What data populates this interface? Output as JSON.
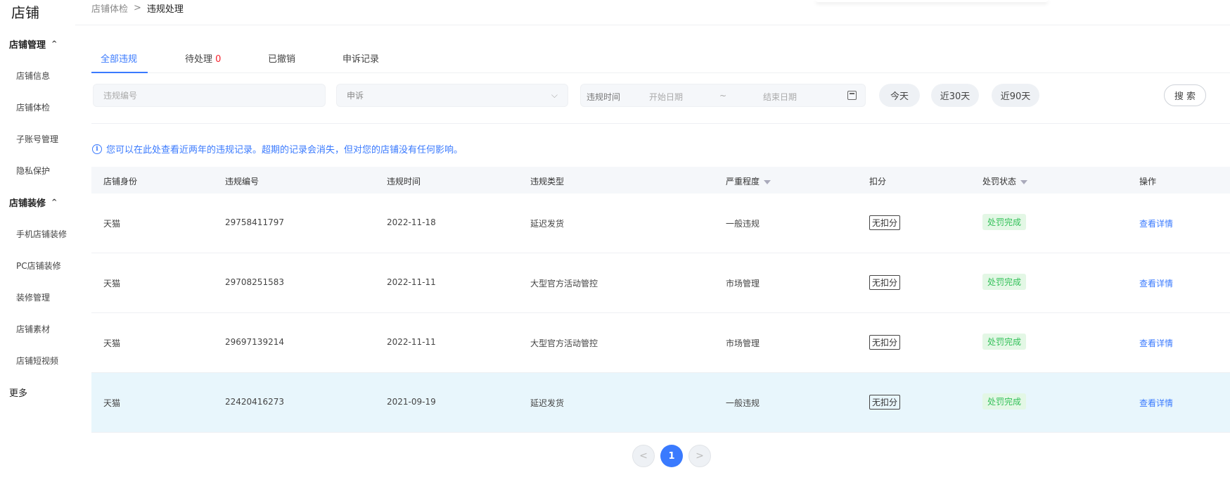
{
  "sidebar": {
    "brand": "店铺",
    "sections": [
      {
        "label": "店铺管理",
        "items": [
          "店铺信息",
          "店铺体检",
          "子账号管理",
          "隐私保护"
        ]
      },
      {
        "label": "店铺装修",
        "items": [
          "手机店铺装修",
          "PC店铺装修",
          "装修管理",
          "店铺素材",
          "店铺短视频"
        ]
      }
    ],
    "more": "更多",
    "chevron": "^"
  },
  "breadcrumb": {
    "parent": "店铺体检",
    "separator": ">",
    "current": "违规处理"
  },
  "tabs": [
    {
      "label": "全部违规"
    },
    {
      "label": "待处理",
      "count": "0"
    },
    {
      "label": "已撤销"
    },
    {
      "label": "申诉记录"
    }
  ],
  "filters": {
    "violation_id_placeholder": "违规编号",
    "appeal_select": "申诉",
    "date_label": "违规时间",
    "start_placeholder": "开始日期",
    "tilde": "~",
    "end_placeholder": "结束日期",
    "quick": [
      "今天",
      "近30天",
      "近90天"
    ],
    "search": "搜 索"
  },
  "notice": {
    "icon": "i",
    "text": "您可以在此处查看近两年的违规记录。超期的记录会消失，但对您的店铺没有任何影响。"
  },
  "table": {
    "headers": [
      "店铺身份",
      "违规编号",
      "违规时间",
      "违规类型",
      "严重程度",
      "扣分",
      "处罚状态",
      "操作"
    ],
    "rows": [
      {
        "identity": "天猫",
        "id": "29758411797",
        "date": "2022-11-18",
        "type": "延迟发货",
        "severity": "一般违规",
        "points": "无扣分",
        "status": "处罚完成",
        "action": "查看详情"
      },
      {
        "identity": "天猫",
        "id": "29708251583",
        "date": "2022-11-11",
        "type": "大型官方活动管控",
        "severity": "市场管理",
        "points": "无扣分",
        "status": "处罚完成",
        "action": "查看详情"
      },
      {
        "identity": "天猫",
        "id": "29697139214",
        "date": "2022-11-11",
        "type": "大型官方活动管控",
        "severity": "市场管理",
        "points": "无扣分",
        "status": "处罚完成",
        "action": "查看详情"
      },
      {
        "identity": "天猫",
        "id": "22420416273",
        "date": "2021-09-19",
        "type": "延迟发货",
        "severity": "一般违规",
        "points": "无扣分",
        "status": "处罚完成",
        "action": "查看详情"
      }
    ]
  },
  "pagination": {
    "prev": "<",
    "current": "1",
    "next": ">"
  },
  "colors": {
    "accent": "#3a7afe",
    "danger": "#f5222d",
    "success": "#34c15a",
    "highlight_row": "#e8f6fc"
  }
}
